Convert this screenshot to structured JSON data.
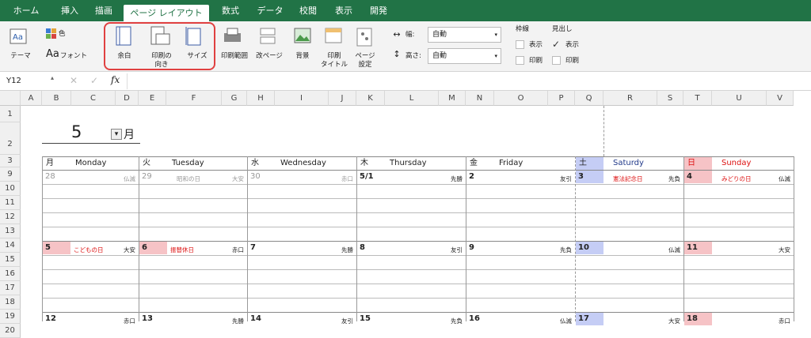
{
  "tabs": [
    "ホーム",
    "挿入",
    "描画",
    "ページ レイアウト",
    "数式",
    "データ",
    "校閲",
    "表示",
    "開発"
  ],
  "ribbon": {
    "theme": "テーマ",
    "color": "色",
    "font": "フォント",
    "margins": "余白",
    "orientation": [
      "印刷の",
      "向き"
    ],
    "size": "サイズ",
    "print_area": "印刷範囲",
    "breaks": "改ページ",
    "background": "背景",
    "print_titles": [
      "印刷",
      "タイトル"
    ],
    "page_setup": [
      "ページ",
      "設定"
    ],
    "width_label": "幅:",
    "width_value": "自動",
    "height_label": "高さ:",
    "height_value": "自動",
    "gridlines": "枠線",
    "headings": "見出し",
    "view": "表示",
    "print": "印刷"
  },
  "formula_bar": {
    "name_box": "Y12",
    "fx": "fx"
  },
  "columns": [
    "A",
    "B",
    "C",
    "D",
    "E",
    "F",
    "G",
    "H",
    "I",
    "J",
    "K",
    "L",
    "M",
    "N",
    "O",
    "P",
    "Q",
    "R",
    "S",
    "T",
    "U",
    "V"
  ],
  "rows": [
    "1",
    "2",
    "3",
    "9",
    "10",
    "11",
    "12",
    "13",
    "14",
    "15",
    "16",
    "17",
    "18",
    "19",
    "20"
  ],
  "calendar": {
    "month": "5",
    "month_suffix": "月",
    "headers": [
      {
        "kanji": "月",
        "en": "Monday"
      },
      {
        "kanji": "火",
        "en": "Tuesday"
      },
      {
        "kanji": "水",
        "en": "Wednesday"
      },
      {
        "kanji": "木",
        "en": "Thursday"
      },
      {
        "kanji": "金",
        "en": "Friday"
      },
      {
        "kanji": "土",
        "en": "Saturdy"
      },
      {
        "kanji": "日",
        "en": "Sunday"
      }
    ],
    "week1": [
      {
        "d": "28",
        "r": "仏滅",
        "h": ""
      },
      {
        "d": "29",
        "r": "大安",
        "h": "昭和の日"
      },
      {
        "d": "30",
        "r": "赤口",
        "h": ""
      },
      {
        "d": "5/1",
        "r": "先勝",
        "h": ""
      },
      {
        "d": "2",
        "r": "友引",
        "h": ""
      },
      {
        "d": "3",
        "r": "先負",
        "h": "憲法記念日"
      },
      {
        "d": "4",
        "r": "仏滅",
        "h": "みどりの日"
      }
    ],
    "week2": [
      {
        "d": "5",
        "r": "大安",
        "h": "こどもの日"
      },
      {
        "d": "6",
        "r": "赤口",
        "h": "振替休日"
      },
      {
        "d": "7",
        "r": "先勝",
        "h": ""
      },
      {
        "d": "8",
        "r": "友引",
        "h": ""
      },
      {
        "d": "9",
        "r": "先負",
        "h": ""
      },
      {
        "d": "10",
        "r": "仏滅",
        "h": ""
      },
      {
        "d": "11",
        "r": "大安",
        "h": ""
      }
    ],
    "week3": [
      {
        "d": "12",
        "r": "赤口"
      },
      {
        "d": "13",
        "r": "先勝"
      },
      {
        "d": "14",
        "r": "友引"
      },
      {
        "d": "15",
        "r": "先負"
      },
      {
        "d": "16",
        "r": "仏滅"
      },
      {
        "d": "17",
        "r": "大安"
      },
      {
        "d": "18",
        "r": "赤口"
      }
    ]
  },
  "colors": {
    "accent": "#217346",
    "sat_fill": "#c5cdf5",
    "sun_fill": "#f6c3c6",
    "holiday_text": "#dd1111",
    "highlight_border": "#e04040"
  }
}
